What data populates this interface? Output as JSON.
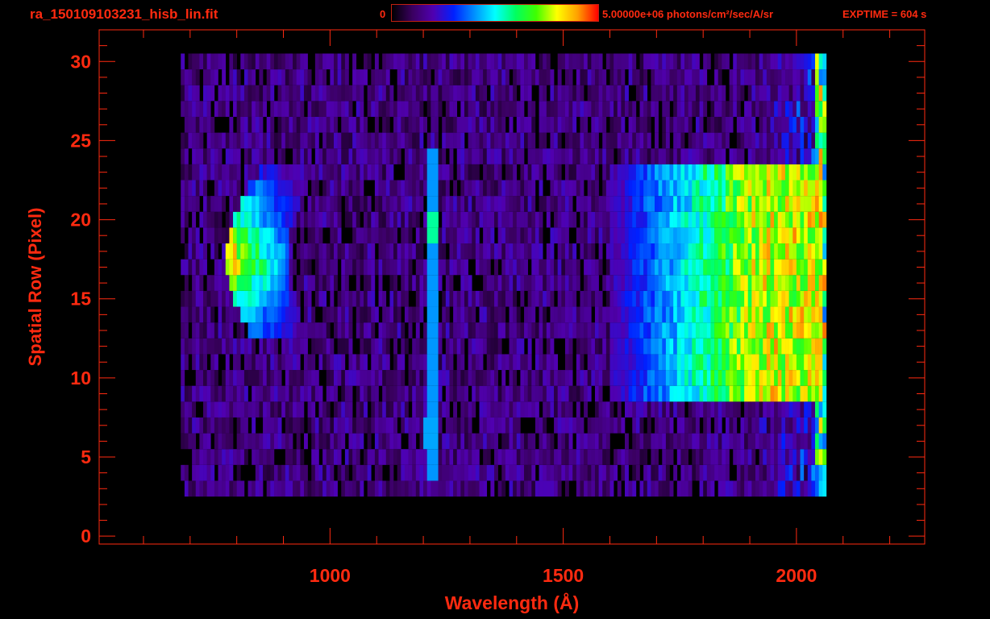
{
  "header": {
    "title": "ra_150109103231_hisb_lin.fit",
    "colorbar_min": "0",
    "colorbar_max_label": "5.00000e+06 photons/cm²/sec/A/sr",
    "exptime": "EXPTIME = 604 s"
  },
  "chart_data": {
    "type": "heatmap",
    "title": "ra_150109103231_hisb_lin.fit",
    "xlabel": "Wavelength (Å)",
    "ylabel": "Spatial Row (Pixel)",
    "xlim": [
      505,
      2275
    ],
    "ylim": [
      -0.5,
      32
    ],
    "xticks": [
      1000,
      1500,
      2000
    ],
    "xtick_labels": [
      "1000",
      "1500",
      "2000"
    ],
    "yticks": [
      0,
      5,
      10,
      15,
      20,
      25,
      30
    ],
    "ytick_labels": [
      "0",
      "5",
      "10",
      "15",
      "20",
      "25",
      "30"
    ],
    "colorbar": {
      "min": 0,
      "max": 5000000,
      "units": "photons/cm2/sec/A/sr",
      "colormap": "rainbow"
    },
    "data_extent": {
      "wavelength": [
        680,
        2060
      ],
      "rows": [
        3,
        30
      ]
    },
    "background_level": 0.12,
    "features": [
      {
        "name": "arc-emission",
        "wavelength": [
          775,
          900
        ],
        "rows": [
          13,
          23
        ],
        "peak": 0.95
      },
      {
        "name": "lyman-alpha",
        "wavelength": [
          1205,
          1225
        ],
        "rows": [
          4,
          24
        ],
        "peak": 0.45
      },
      {
        "name": "lyman-alpha-bright-knot",
        "wavelength": [
          1200,
          1230
        ],
        "rows": [
          6,
          7
        ],
        "peak": 0.42
      },
      {
        "name": "continuum",
        "wavelength": [
          1600,
          2050
        ],
        "rows": [
          9,
          23
        ],
        "peak": 0.6
      },
      {
        "name": "red-edge",
        "wavelength": [
          2040,
          2060
        ],
        "rows": [
          2,
          30
        ],
        "peak": 0.85
      }
    ]
  },
  "colors": {
    "axis": "#ff2a10"
  }
}
